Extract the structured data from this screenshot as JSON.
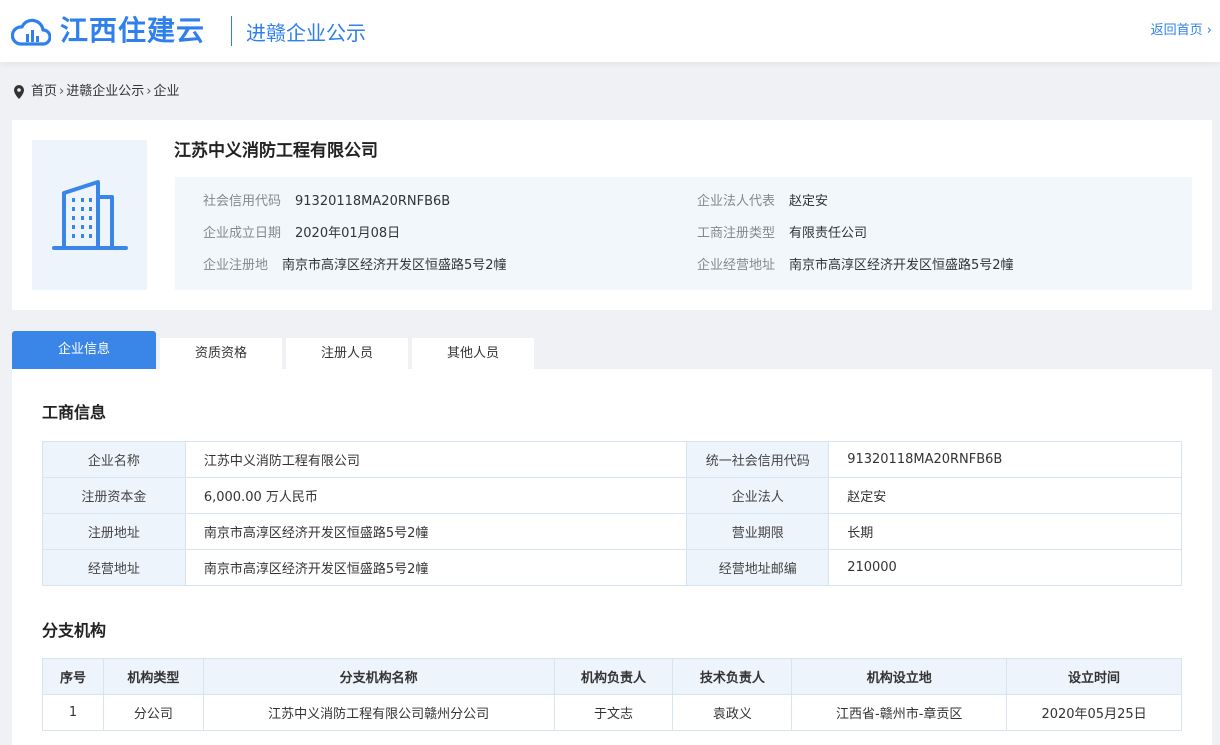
{
  "header": {
    "brand": "江西住建云",
    "subtitle": "进赣企业公示",
    "home_link": "返回首页"
  },
  "breadcrumb": [
    "首页",
    "进赣企业公示",
    "企业"
  ],
  "company": {
    "name": "江苏中义消防工程有限公司",
    "fields": [
      {
        "key": "社会信用代码",
        "value": "91320118MA20RNFB6B"
      },
      {
        "key": "企业法人代表",
        "value": "赵定安"
      },
      {
        "key": "企业成立日期",
        "value": "2020年01月08日"
      },
      {
        "key": "工商注册类型",
        "value": "有限责任公司"
      },
      {
        "key": "企业注册地",
        "value": "南京市高淳区经济开发区恒盛路5号2幢"
      },
      {
        "key": "企业经营地址",
        "value": "南京市高淳区经济开发区恒盛路5号2幢"
      }
    ]
  },
  "tabs": [
    "企业信息",
    "资质资格",
    "注册人员",
    "其他人员"
  ],
  "business": {
    "title": "工商信息",
    "rows": [
      [
        "企业名称",
        "江苏中义消防工程有限公司",
        "统一社会信用代码",
        "91320118MA20RNFB6B"
      ],
      [
        "注册资本金",
        "6,000.00 万人民币",
        "企业法人",
        "赵定安"
      ],
      [
        "注册地址",
        "南京市高淳区经济开发区恒盛路5号2幢",
        "营业期限",
        "长期"
      ],
      [
        "经营地址",
        "南京市高淳区经济开发区恒盛路5号2幢",
        "经营地址邮编",
        "210000"
      ]
    ]
  },
  "branches": {
    "title": "分支机构",
    "headers": [
      "序号",
      "机构类型",
      "分支机构名称",
      "机构负责人",
      "技术负责人",
      "机构设立地",
      "设立时间"
    ],
    "rows": [
      [
        "1",
        "分公司",
        "江苏中义消防工程有限公司赣州分公司",
        "于文志",
        "袁政义",
        "江西省-赣州市-章贡区",
        "2020年05月25日"
      ]
    ]
  },
  "colors": {
    "brand": "#2f80ed",
    "tab_active": "#3a86e8",
    "label_bg": "#eef4fb"
  }
}
